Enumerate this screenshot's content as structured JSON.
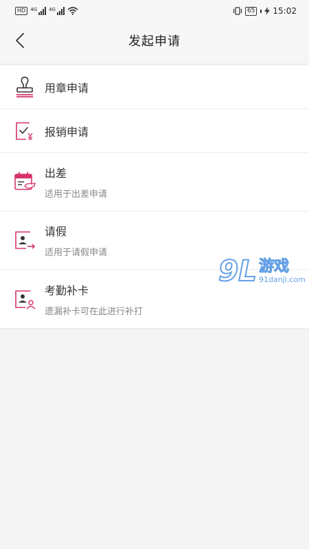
{
  "status": {
    "hd": "HD",
    "net_a": "4G",
    "net_b": "4G",
    "battery": "65",
    "time": "15:02"
  },
  "nav": {
    "title": "发起申请"
  },
  "items": [
    {
      "title": "用章申请"
    },
    {
      "title": "报销申请"
    },
    {
      "title": "出差",
      "subtitle": "适用于出差申请"
    },
    {
      "title": "请假",
      "subtitle": "适用于请假申请"
    },
    {
      "title": "考勤补卡",
      "subtitle": "遗漏补卡可在此进行补打"
    }
  ],
  "watermark": {
    "mark": "9L",
    "text": "游戏",
    "url": "91danji.com"
  },
  "colors": {
    "accent": "#d6336c",
    "watermark": "#4a90e2"
  }
}
